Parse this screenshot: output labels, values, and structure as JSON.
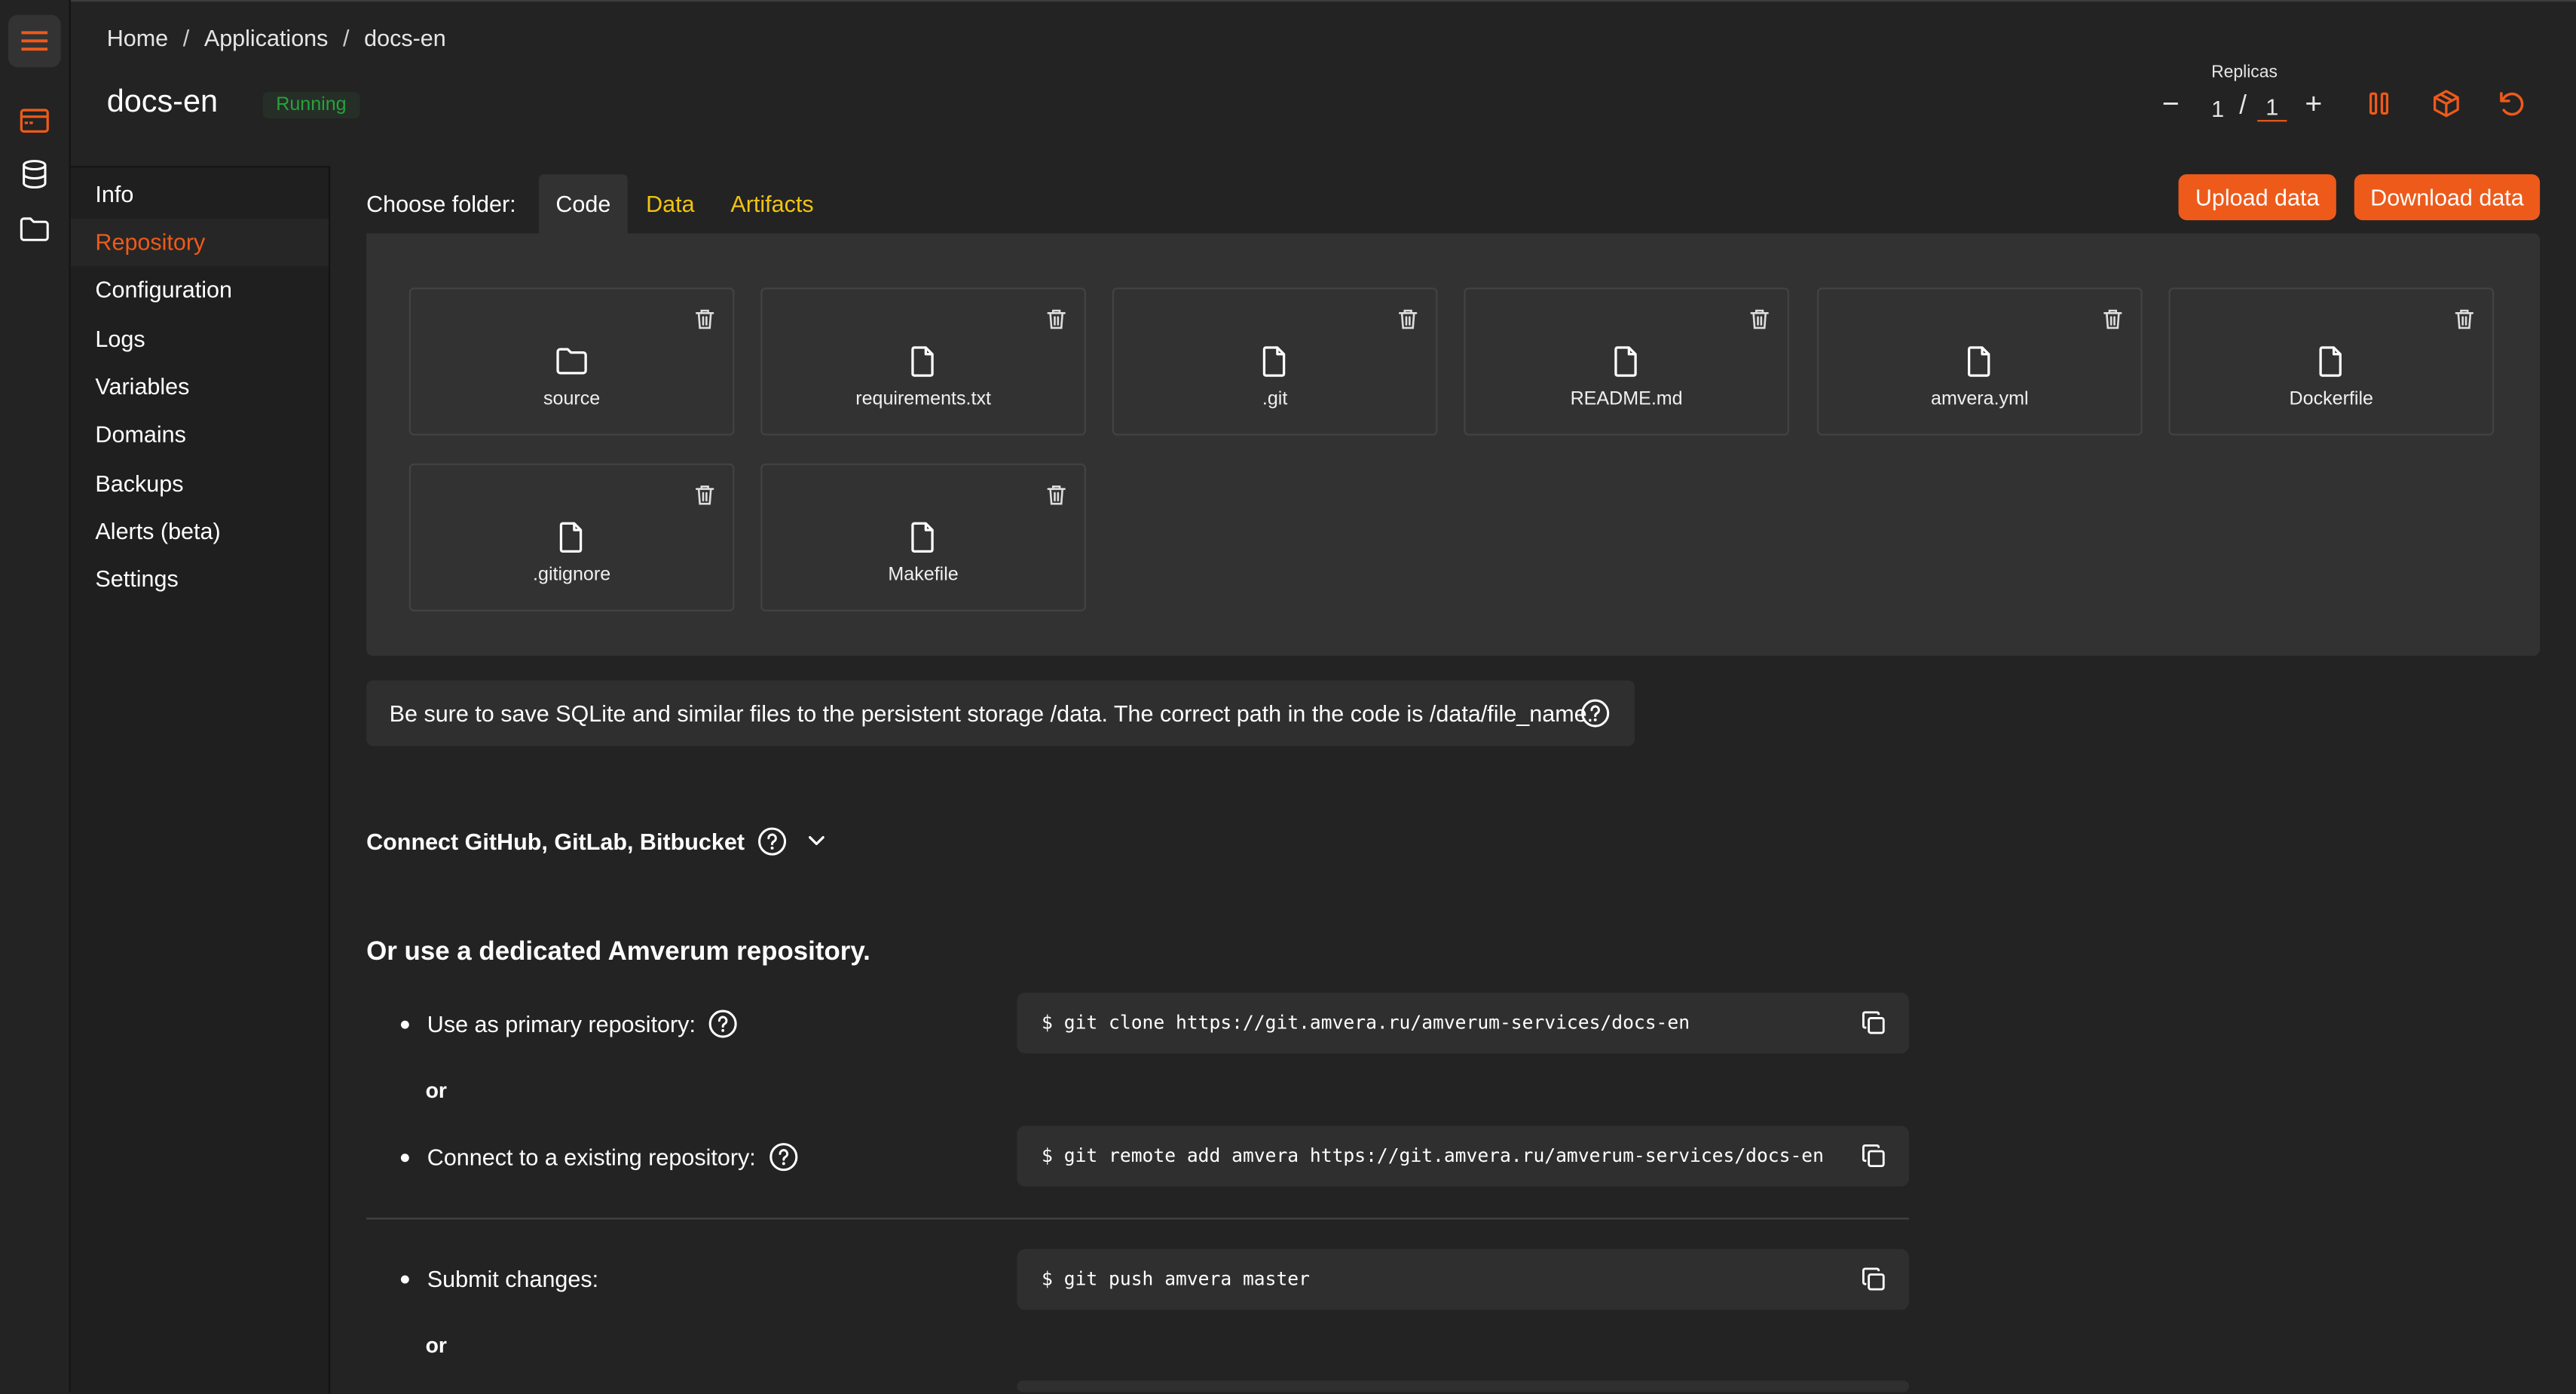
{
  "breadcrumb": {
    "home": "Home",
    "applications": "Applications",
    "current": "docs-en",
    "separator": "/"
  },
  "app": {
    "name": "docs-en",
    "status": "Running"
  },
  "replicas": {
    "label": "Replicas",
    "current": "1",
    "separator": "/",
    "target": "1",
    "minus": "−",
    "plus": "+"
  },
  "header_icons": [
    "pause-icon",
    "box-icon",
    "restart-icon"
  ],
  "rail": {
    "icons": [
      "menu-icon",
      "apps-icon",
      "database-icon",
      "folder-icon"
    ]
  },
  "sidebar": {
    "items": [
      {
        "label": "Info"
      },
      {
        "label": "Repository"
      },
      {
        "label": "Configuration"
      },
      {
        "label": "Logs"
      },
      {
        "label": "Variables"
      },
      {
        "label": "Domains"
      },
      {
        "label": "Backups"
      },
      {
        "label": "Alerts (beta)"
      },
      {
        "label": "Settings"
      }
    ],
    "active": "Repository"
  },
  "folder": {
    "label": "Choose folder:",
    "tabs": [
      {
        "label": "Code"
      },
      {
        "label": "Data"
      },
      {
        "label": "Artifacts"
      }
    ],
    "active_tab": "Code",
    "upload_label": "Upload data",
    "download_label": "Download data"
  },
  "files": [
    {
      "name": "source",
      "type": "folder"
    },
    {
      "name": "requirements.txt",
      "type": "file"
    },
    {
      "name": ".git",
      "type": "file"
    },
    {
      "name": "README.md",
      "type": "file"
    },
    {
      "name": "amvera.yml",
      "type": "file"
    },
    {
      "name": "Dockerfile",
      "type": "file"
    },
    {
      "name": ".gitignore",
      "type": "file"
    },
    {
      "name": "Makefile",
      "type": "file"
    }
  ],
  "note": "Be sure to save SQLite and similar files to the persistent storage /data. The correct path in the code is /data/file_name.",
  "connect": {
    "label": "Connect GitHub, GitLab, Bitbucket"
  },
  "dedicated": {
    "heading": "Or use a dedicated Amverum repository.",
    "primary_label": "Use as primary repository:",
    "primary_prompt": "$",
    "primary_cmd": "git clone https://git.amvera.ru/amverum-services/docs-en",
    "or1": "or",
    "existing_label": "Connect to a existing repository:",
    "existing_prompt": "$",
    "existing_cmd": "git remote add amvera https://git.amvera.ru/amverum-services/docs-en",
    "submit_label": "Submit changes:",
    "submit_prompt": "$",
    "submit_cmd": "git push amvera master",
    "or2": "or"
  },
  "colors": {
    "accent": "#ee5a1a",
    "tab_link": "#f1c40f",
    "running": "#28a23a",
    "background": "#232323",
    "panel": "#323232"
  }
}
